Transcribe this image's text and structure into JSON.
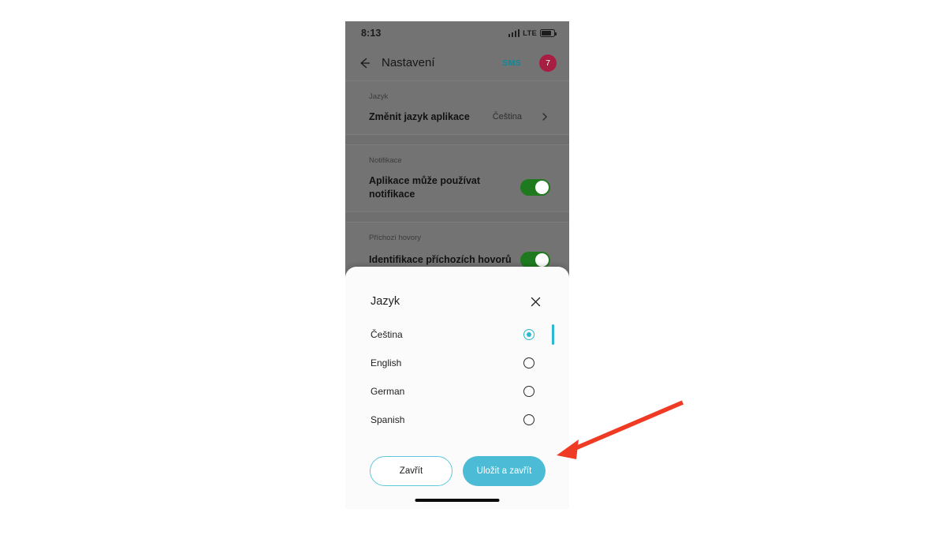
{
  "phone": {
    "status_bar": {
      "time": "8:13",
      "network_label": "LTE",
      "signal_icon": "signal-bars-icon",
      "battery_icon": "battery-icon"
    },
    "app_bar": {
      "back_icon": "back-arrow-icon",
      "title": "Nastavení",
      "sms_label": "SMS",
      "badge_count": "7"
    },
    "settings": {
      "sections": [
        {
          "label": "Jazyk",
          "row_title": "Změnit jazyk aplikace",
          "row_value": "Čeština",
          "chevron_icon": "chevron-right-icon"
        },
        {
          "label": "Notifikace",
          "row_title": "Aplikace může používat notifikace",
          "toggle_state": "on"
        },
        {
          "label": "Příchozí hovory",
          "row_title": "Identifikace příchozích hovorů",
          "toggle_state": "on"
        }
      ]
    },
    "sheet": {
      "title": "Jazyk",
      "close_icon": "close-x-icon",
      "options": [
        {
          "label": "Čeština",
          "selected": true
        },
        {
          "label": "English",
          "selected": false
        },
        {
          "label": "German",
          "selected": false
        },
        {
          "label": "Spanish",
          "selected": false
        }
      ],
      "buttons": {
        "cancel_label": "Zavřít",
        "save_label": "Uložit a zavřít"
      }
    }
  },
  "annotation": {
    "arrow_icon": "red-arrow-icon",
    "arrow_color": "#ef3b24",
    "points_at": "Uložit a zavřít"
  },
  "colors": {
    "accent_cyan": "#4cbcd6",
    "radio_cyan": "#2cb7d4",
    "toggle_green": "#1f7a1f",
    "badge_red": "#a81e43",
    "sms_teal": "#0c8b9b",
    "dim_overlay": "#737373"
  }
}
